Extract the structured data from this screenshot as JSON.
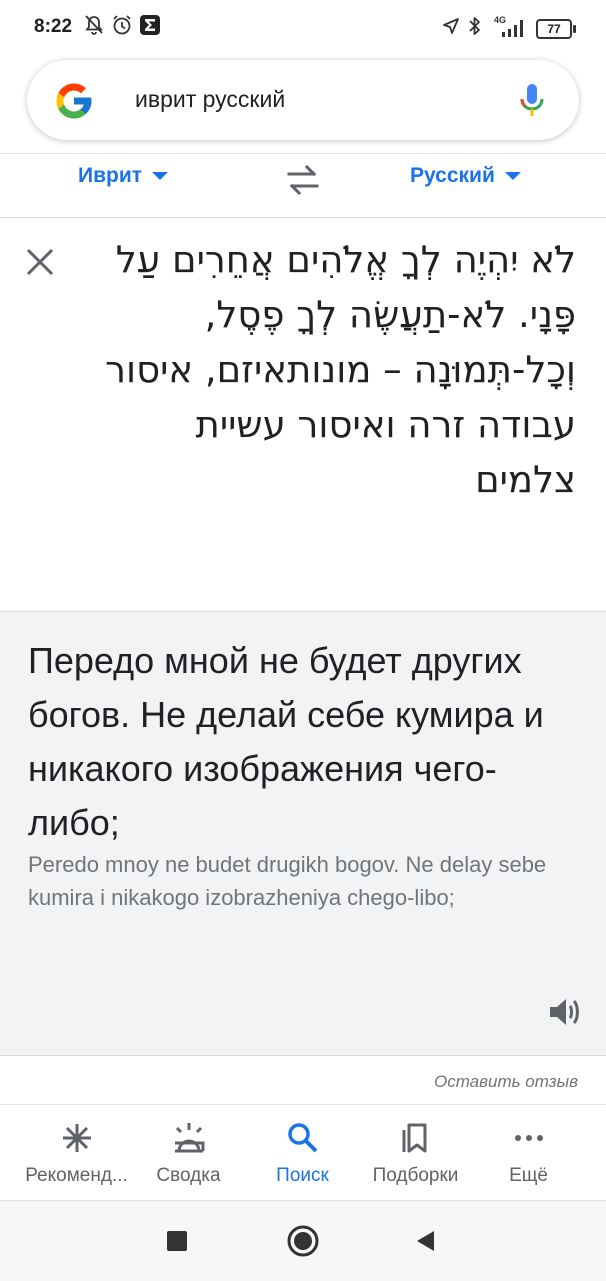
{
  "status_bar": {
    "time": "8:22",
    "network": "4G",
    "battery": "77"
  },
  "search": {
    "query": "иврит русский"
  },
  "languages": {
    "source": "Иврит",
    "target": "Русский"
  },
  "source_text": "לֹא יִהְיֶה לְךָ אֱלֹהִים אֲחֵרִים עַל פָּנָי. לֹא-תַעֲשֶׂה לְךָ פֶסֶל, וְכָל-תְּמוּנָה – מונותאיזם, איסור עבודה זרה ואיסור עשיית צלמים",
  "translation": {
    "text": "Передо мной не будет других богов. Не делай себе кумира и никакого изображения чего-либо;",
    "transliteration": "Peredo mnoy ne budet drugikh bogov. Ne delay sebe kumira i nikakogo izobrazheniya chego-libo;"
  },
  "feedback_link": "Оставить отзыв",
  "bottom_nav": [
    {
      "label": "Рекоменд...",
      "icon": "asterisk-icon"
    },
    {
      "label": "Сводка",
      "icon": "sunrise-icon"
    },
    {
      "label": "Поиск",
      "icon": "search-icon"
    },
    {
      "label": "Подборки",
      "icon": "collections-icon"
    },
    {
      "label": "Ещё",
      "icon": "more-icon"
    }
  ],
  "colors": {
    "accent": "#1a73e8",
    "panel": "#f1f3f4"
  }
}
